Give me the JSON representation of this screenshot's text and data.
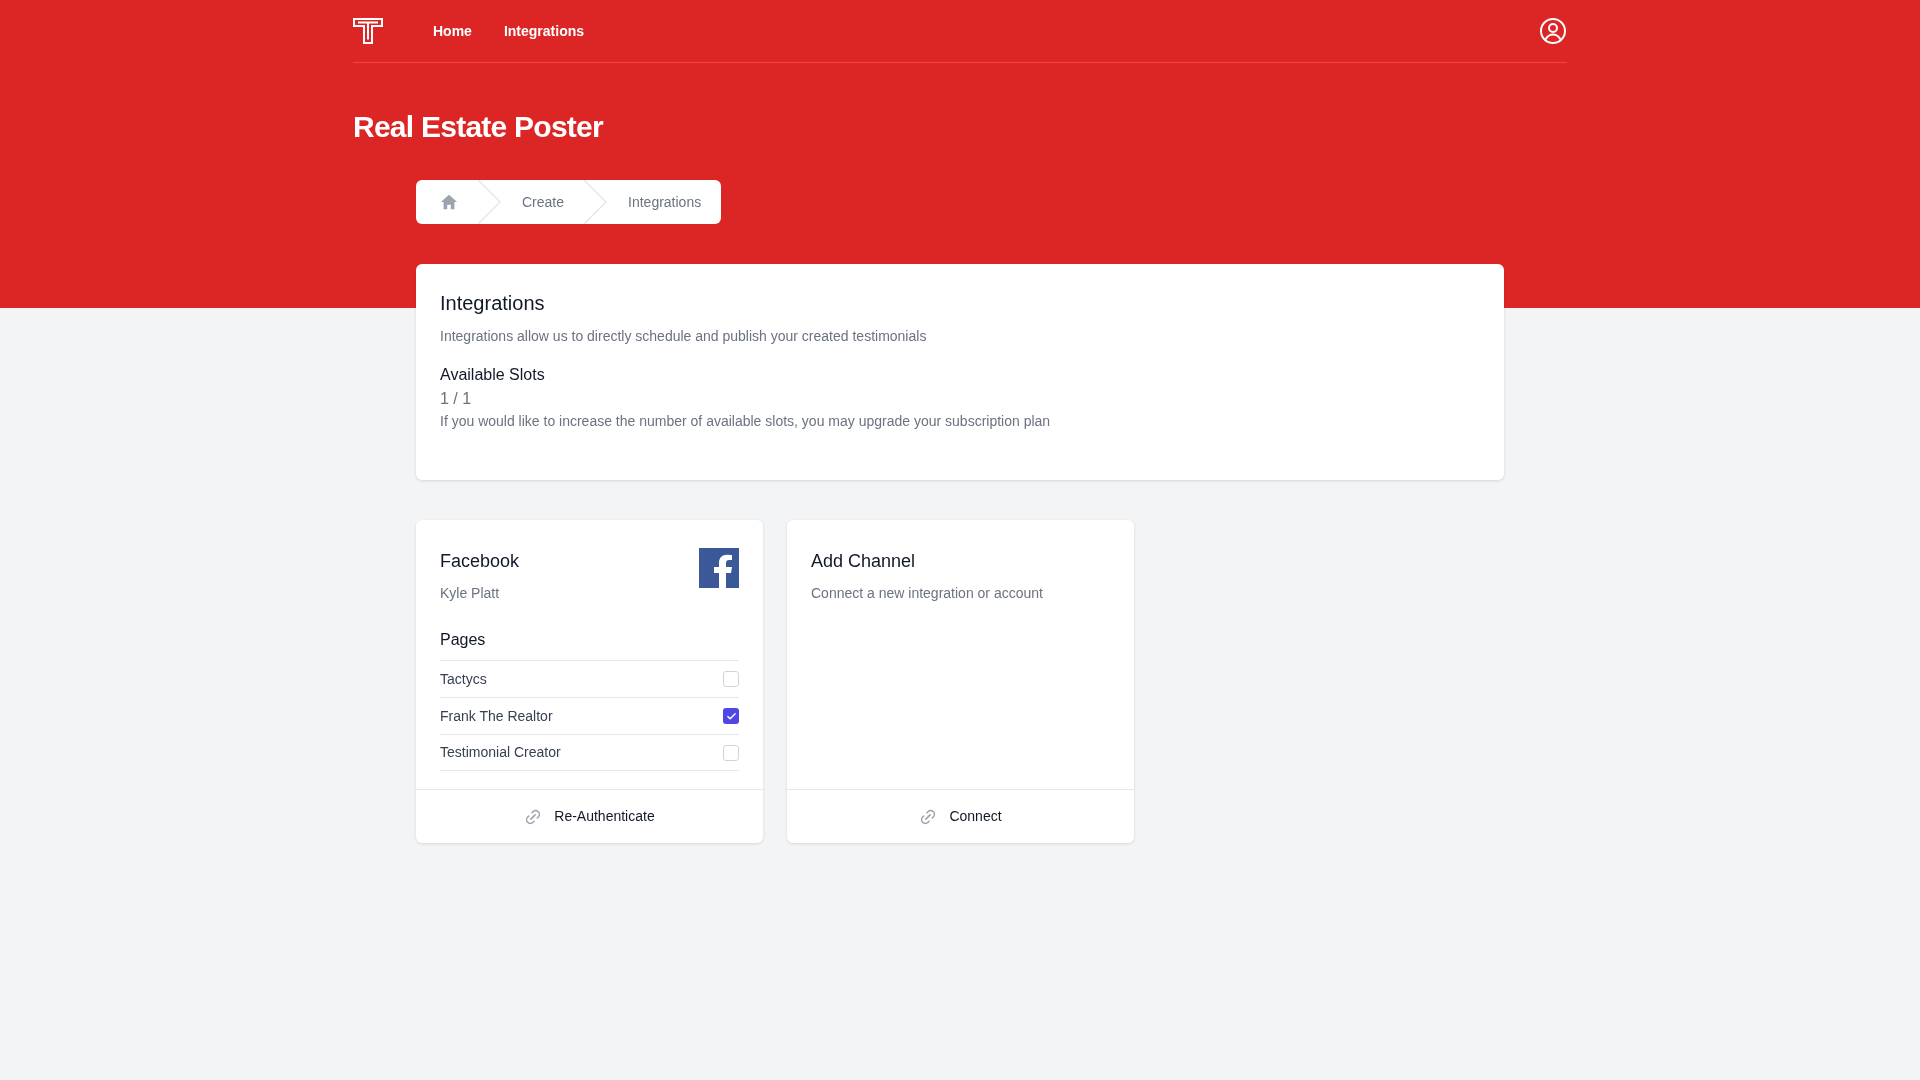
{
  "nav": {
    "links": [
      {
        "label": "Home"
      },
      {
        "label": "Integrations"
      }
    ]
  },
  "page_title": "Real Estate Poster",
  "breadcrumb": [
    "Create",
    "Integrations"
  ],
  "overview": {
    "title": "Integrations",
    "description": "Integrations allow us to directly schedule and publish your created testimonials",
    "slots_label": "Available Slots",
    "slots_value": "1 / 1",
    "note": "If you would like to increase the number of available slots, you may upgrade your subscription plan"
  },
  "channels": [
    {
      "kind": "facebook",
      "title": "Facebook",
      "subtitle": "Kyle Platt",
      "pages_title": "Pages",
      "pages": [
        {
          "name": "Tactycs",
          "checked": false
        },
        {
          "name": "Frank The Realtor",
          "checked": true
        },
        {
          "name": "Testimonial Creator",
          "checked": false
        }
      ],
      "action": "Re-Authenticate"
    },
    {
      "kind": "add",
      "title": "Add Channel",
      "subtitle": "Connect a new integration or account",
      "action": "Connect"
    }
  ]
}
